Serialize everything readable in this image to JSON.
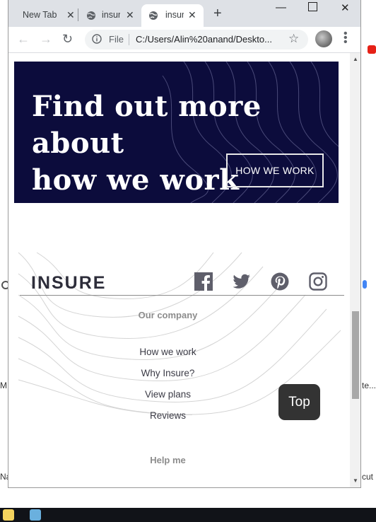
{
  "browser": {
    "tabs": [
      {
        "label": "New Tab",
        "active": false
      },
      {
        "label": "insure",
        "active": false
      },
      {
        "label": "insure",
        "active": true
      }
    ],
    "address": {
      "file_label": "File",
      "url": "C:/Users/Alin%20anand/Deskto..."
    }
  },
  "page": {
    "banner": {
      "heading_line1": "Find out more about",
      "heading_line2": "how we work",
      "button_label": "HOW WE WORK"
    },
    "footer": {
      "logo": "INSURE",
      "social": [
        "facebook-icon",
        "twitter-icon",
        "pinterest-icon",
        "instagram-icon"
      ],
      "company_title": "Our company",
      "company_links": [
        "How we work",
        "Why Insure?",
        "View plans",
        "Reviews"
      ],
      "help_title": "Help me"
    },
    "top_button": "Top"
  },
  "desktop": {
    "left_fragments": [
      "M",
      "Na"
    ],
    "right_fragments": [
      "te...",
      "cut"
    ]
  },
  "colors": {
    "banner_bg": "#0c0c3c",
    "tab_strip": "#dee1e6",
    "text_dark": "#3b3b46",
    "muted": "#8c8c8c"
  }
}
